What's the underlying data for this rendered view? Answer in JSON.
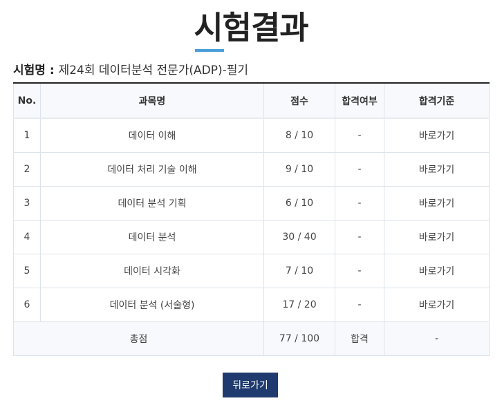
{
  "page": {
    "title_first": "시",
    "title_rest": "험결과",
    "accent_color": "#4a9fd8"
  },
  "exam": {
    "label": "시험명",
    "separator": " : ",
    "name": "제24회 데이터분석 전문가(ADP)-필기"
  },
  "table": {
    "headers": {
      "no": "No.",
      "subject": "과목명",
      "score": "점수",
      "pass": "합격여부",
      "criteria": "합격기준"
    },
    "rows": [
      {
        "no": "1",
        "subject": "데이터 이해",
        "score": "8 / 10",
        "pass": "-",
        "criteria": "바로가기"
      },
      {
        "no": "2",
        "subject": "데이터 처리 기술 이해",
        "score": "9 / 10",
        "pass": "-",
        "criteria": "바로가기"
      },
      {
        "no": "3",
        "subject": "데이터 분석 기획",
        "score": "6 / 10",
        "pass": "-",
        "criteria": "바로가기"
      },
      {
        "no": "4",
        "subject": "데이터 분석",
        "score": "30 / 40",
        "pass": "-",
        "criteria": "바로가기"
      },
      {
        "no": "5",
        "subject": "데이터 시각화",
        "score": "7 / 10",
        "pass": "-",
        "criteria": "바로가기"
      },
      {
        "no": "6",
        "subject": "데이터 분석 (서술형)",
        "score": "17 / 20",
        "pass": "-",
        "criteria": "바로가기"
      }
    ],
    "total": {
      "label": "총점",
      "score": "77 / 100",
      "pass": "합격",
      "criteria": "-"
    }
  },
  "back_button": {
    "label": "뒤로가기",
    "color": "#1e3a6e"
  }
}
